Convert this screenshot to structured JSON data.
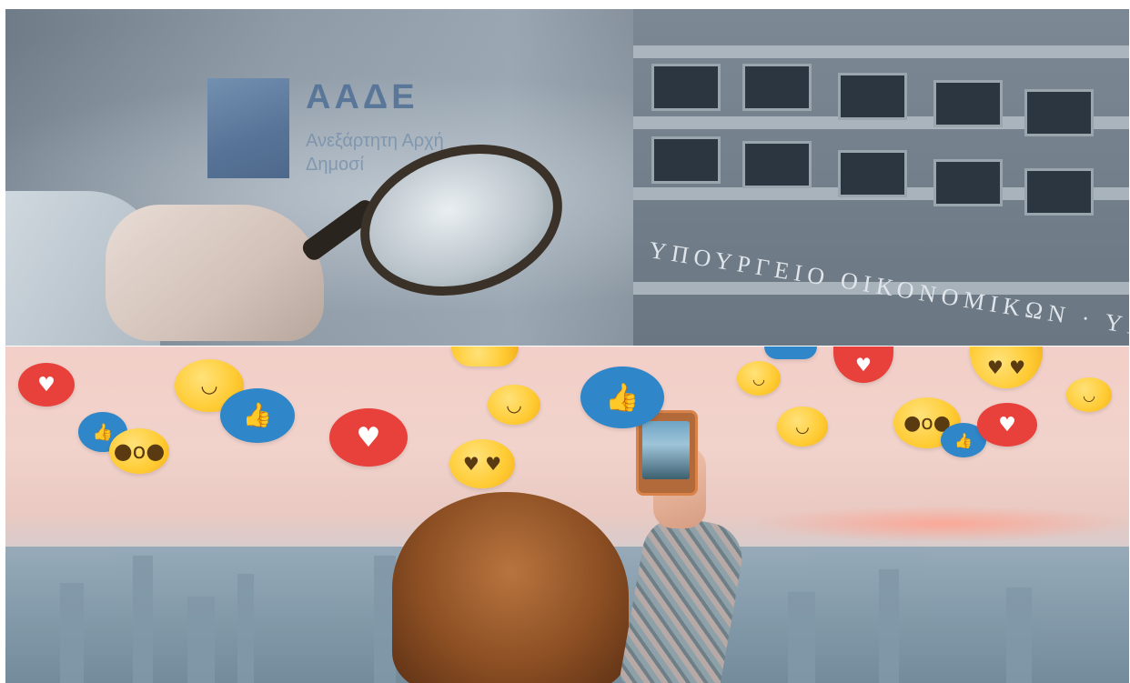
{
  "top_panel": {
    "logo": {
      "title": "ΑΑΔΕ",
      "subtitle_line1": "Ανεξάρτητη Αρχή",
      "subtitle_line2": "Δημοσί"
    },
    "building_sign": "ΥΠΟΥΡΓΕΙΟ ΟΙΚΟΝΟΜΙΚΩΝ · ΥΠΟΥΡΓΕΙΟ"
  },
  "bottom_panel": {
    "reaction_icons": [
      "heart-icon",
      "like-icon",
      "smile-emoji",
      "grin-emoji",
      "heart-eyes-emoji",
      "surprised-emoji"
    ]
  },
  "colors": {
    "heart": "#e8413c",
    "like": "#2f86c8",
    "emoji": "#ffcb33",
    "logo_blue": "#4f6f96"
  }
}
